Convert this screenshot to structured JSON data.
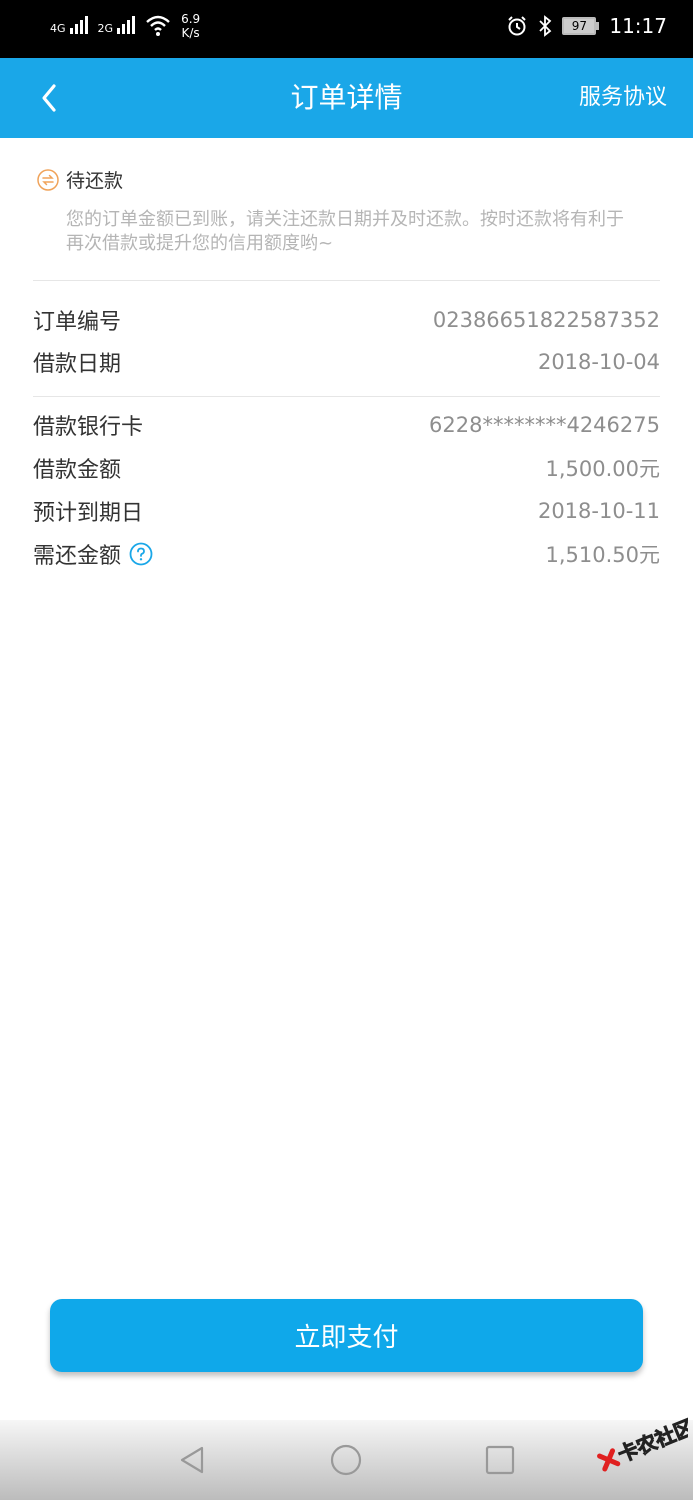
{
  "status_bar": {
    "sim1": "4G",
    "sim2": "2G",
    "speed_value": "6.9",
    "speed_unit": "K/s",
    "battery": "97",
    "time": "11:17",
    "icons": [
      "signal-icon",
      "wifi-icon",
      "alarm-icon",
      "bluetooth-icon",
      "battery-icon"
    ]
  },
  "header": {
    "title": "订单详情",
    "right_link": "服务协议",
    "back_icon": "chevron-left-icon",
    "color": "#1aa7e8"
  },
  "status": {
    "label": "待还款",
    "icon": "exchange-icon",
    "icon_color": "#f0a35a",
    "notice": "您的订单金额已到账，请关注还款日期并及时还款。按时还款将有利于再次借款或提升您的信用额度哟~"
  },
  "details": {
    "order_no_label": "订单编号",
    "order_no_value": "02386651822587352",
    "loan_date_label": "借款日期",
    "loan_date_value": "2018-10-04",
    "bank_card_label": "借款银行卡",
    "bank_card_value": "6228********4246275",
    "amount_label": "借款金额",
    "amount_value": "1,500.00元",
    "due_date_label": "预计到期日",
    "due_date_value": "2018-10-11",
    "repay_label": "需还金额",
    "repay_value": "1,510.50元"
  },
  "pay_button": "立即支付",
  "nav": {
    "icons": [
      "back-triangle-icon",
      "home-circle-icon",
      "recent-square-icon"
    ]
  },
  "watermark": {
    "text": "卡农社区",
    "icon": "watermark-logo-icon"
  }
}
